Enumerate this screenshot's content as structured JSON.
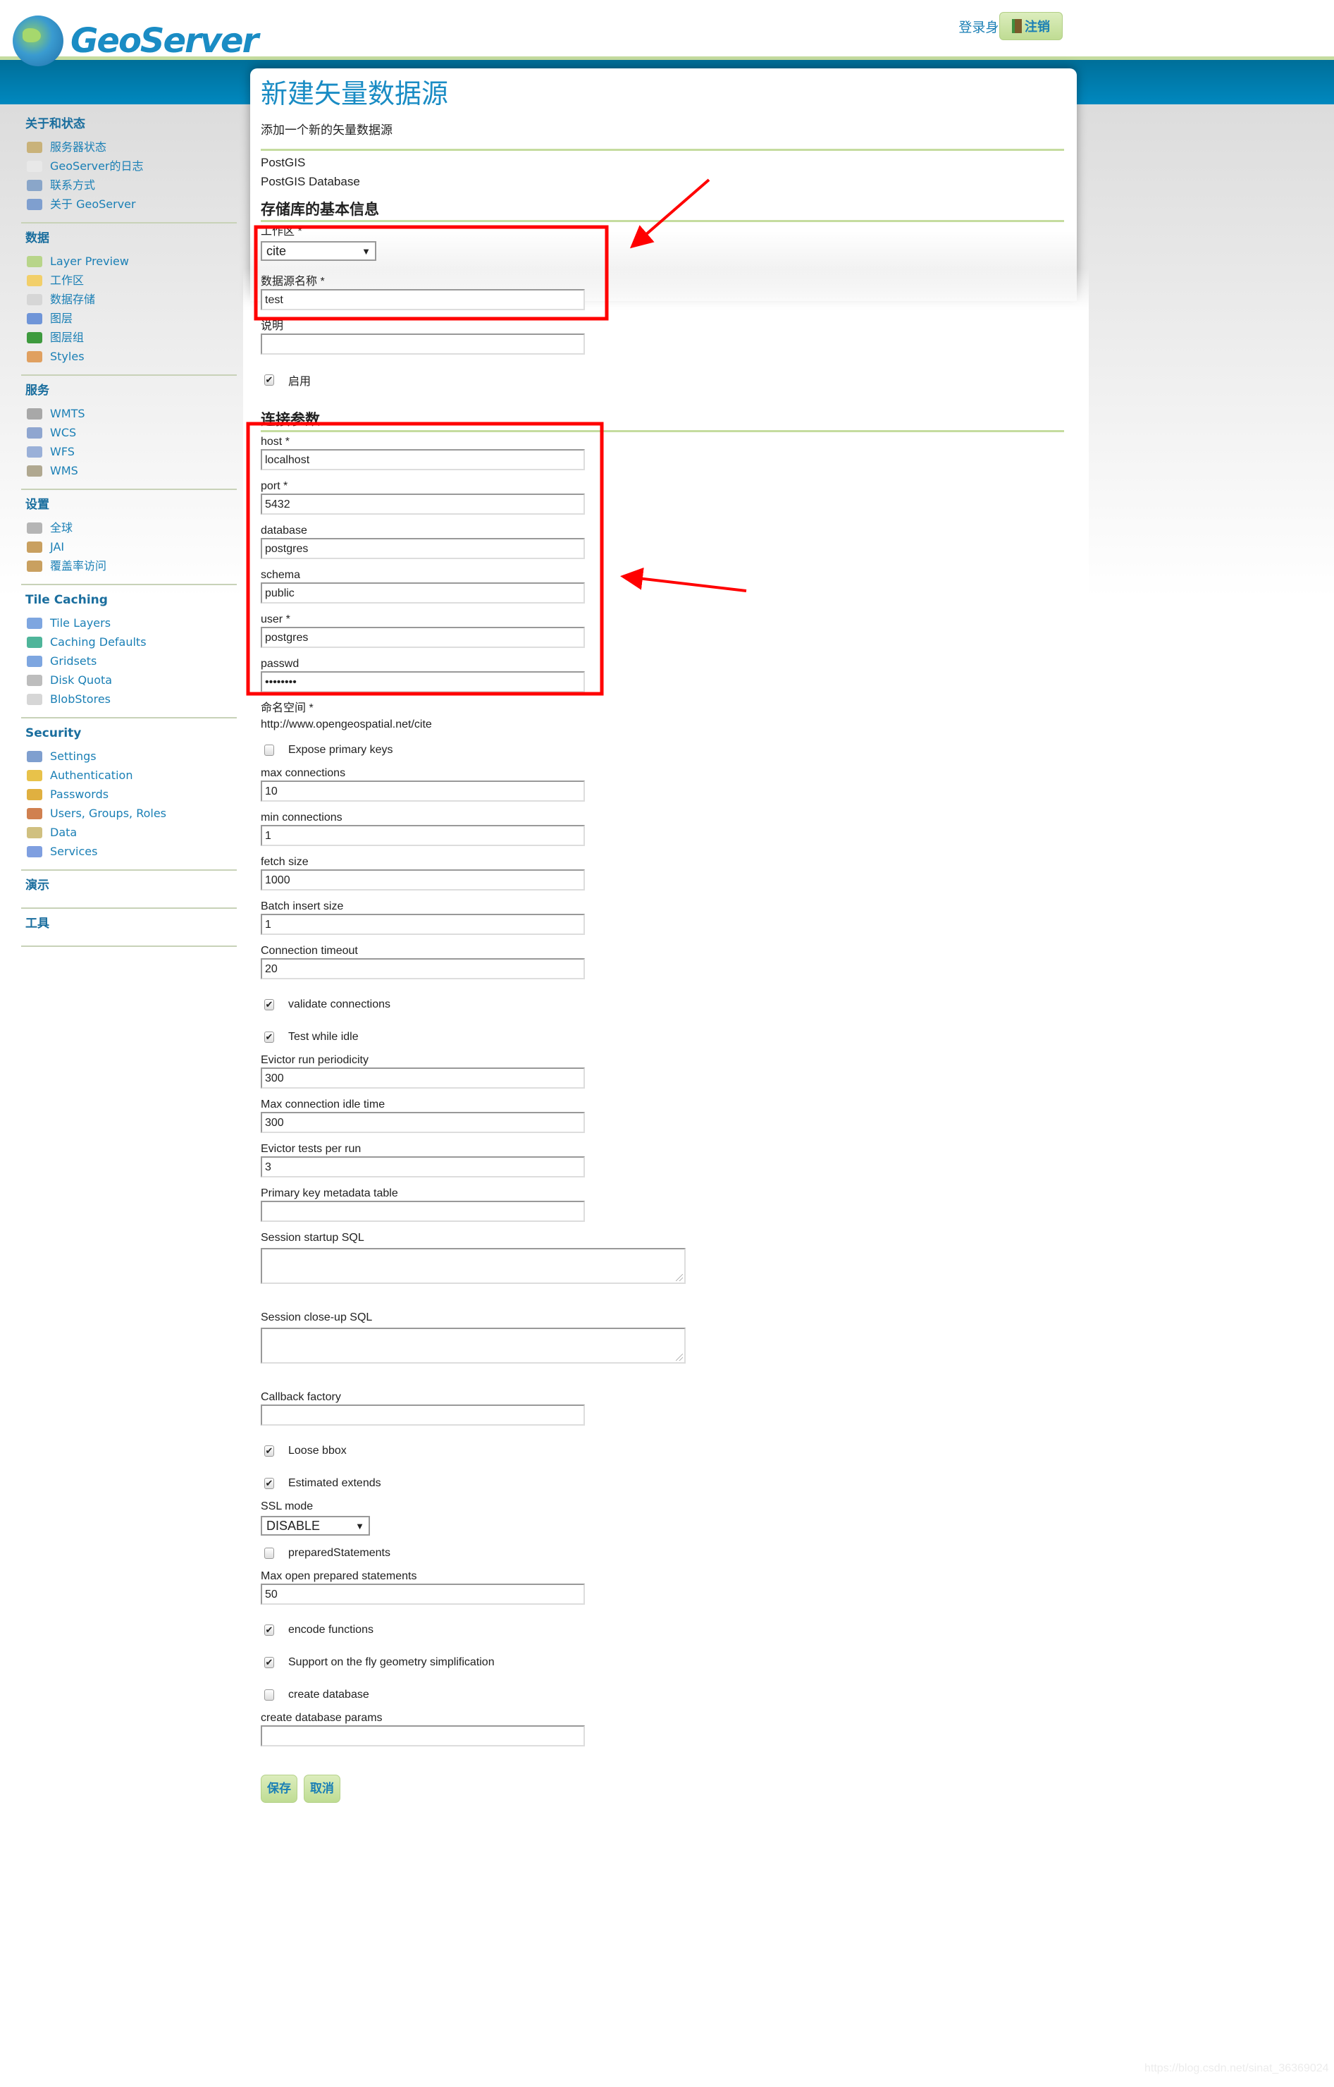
{
  "header": {
    "logo_text": "GeoServer",
    "login_text": "登录身份 admin.",
    "logout_label": "注销"
  },
  "sidebar": [
    {
      "title": "关于和状态",
      "items": [
        {
          "label": "服务器状态",
          "icon": "server-status-icon",
          "color": "#c9b27a"
        },
        {
          "label": "GeoServer的日志",
          "icon": "log-document-icon",
          "color": "#e8e8e8"
        },
        {
          "label": "联系方式",
          "icon": "contact-card-icon",
          "color": "#8aa6c9"
        },
        {
          "label": "关于 GeoServer",
          "icon": "help-icon",
          "color": "#7f9fcf"
        }
      ]
    },
    {
      "title": "数据",
      "items": [
        {
          "label": "Layer Preview",
          "icon": "layer-preview-icon",
          "color": "#b8d58a"
        },
        {
          "label": "工作区",
          "icon": "folder-icon",
          "color": "#f2cf6a"
        },
        {
          "label": "数据存储",
          "icon": "database-icon",
          "color": "#d6d6d6"
        },
        {
          "label": "图层",
          "icon": "layer-icon",
          "color": "#6f95d8"
        },
        {
          "label": "图层组",
          "icon": "layer-group-icon",
          "color": "#3e9a3e"
        },
        {
          "label": "Styles",
          "icon": "palette-icon",
          "color": "#e0a060"
        }
      ]
    },
    {
      "title": "服务",
      "items": [
        {
          "label": "WMTS",
          "icon": "wmts-service-icon",
          "color": "#a8a8a8"
        },
        {
          "label": "WCS",
          "icon": "wcs-service-icon",
          "color": "#8fa6d0"
        },
        {
          "label": "WFS",
          "icon": "wfs-service-icon",
          "color": "#9ab0d8"
        },
        {
          "label": "WMS",
          "icon": "wms-service-icon",
          "color": "#b0a890"
        }
      ]
    },
    {
      "title": "设置",
      "items": [
        {
          "label": "全球",
          "icon": "global-settings-icon",
          "color": "#b5b5b5"
        },
        {
          "label": "JAI",
          "icon": "jai-icon",
          "color": "#c9a060"
        },
        {
          "label": "覆盖率访问",
          "icon": "coverage-access-icon",
          "color": "#c9a060"
        }
      ]
    },
    {
      "title": "Tile Caching",
      "items": [
        {
          "label": "Tile Layers",
          "icon": "tile-layers-icon",
          "color": "#7ea6e0"
        },
        {
          "label": "Caching Defaults",
          "icon": "caching-globe-icon",
          "color": "#4fb59a"
        },
        {
          "label": "Gridsets",
          "icon": "gridsets-icon",
          "color": "#7ea6e0"
        },
        {
          "label": "Disk Quota",
          "icon": "disk-icon",
          "color": "#bdbdbd"
        },
        {
          "label": "BlobStores",
          "icon": "blobstore-icon",
          "color": "#d6d6d6"
        }
      ]
    },
    {
      "title": "Security",
      "items": [
        {
          "label": "Settings",
          "icon": "wrench-icon",
          "color": "#7f9fcf"
        },
        {
          "label": "Authentication",
          "icon": "shield-icon",
          "color": "#e8c24a"
        },
        {
          "label": "Passwords",
          "icon": "lock-icon",
          "color": "#e0b040"
        },
        {
          "label": "Users, Groups, Roles",
          "icon": "users-icon",
          "color": "#d08050"
        },
        {
          "label": "Data",
          "icon": "data-key-icon",
          "color": "#d0c080"
        },
        {
          "label": "Services",
          "icon": "services-key-icon",
          "color": "#7f9fe0"
        }
      ]
    },
    {
      "title": "演示",
      "items": []
    },
    {
      "title": "工具",
      "items": []
    }
  ],
  "main": {
    "title": "新建矢量数据源",
    "description": "添加一个新的矢量数据源",
    "store_type": "PostGIS",
    "store_type_desc": "PostGIS Database",
    "basic_section": "存储库的基本信息",
    "connection_section": "连接参数",
    "save_label": "保存",
    "cancel_label": "取消",
    "basic_fields": [
      {
        "type": "select",
        "label": "工作区 *",
        "value": "cite",
        "name": "workspace-select"
      },
      {
        "type": "text",
        "label": "数据源名称 *",
        "value": "test",
        "name": "datastore-name-input"
      },
      {
        "type": "text",
        "label": "说明",
        "value": "",
        "name": "description-input"
      },
      {
        "type": "checkbox",
        "label": "启用",
        "checked": true,
        "name": "enabled-checkbox"
      }
    ],
    "connection_fields": [
      {
        "type": "text",
        "label": "host *",
        "value": "localhost",
        "name": "host-input"
      },
      {
        "type": "text",
        "label": "port *",
        "value": "5432",
        "name": "port-input"
      },
      {
        "type": "text",
        "label": "database",
        "value": "postgres",
        "name": "database-input"
      },
      {
        "type": "text",
        "label": "schema",
        "value": "public",
        "name": "schema-input"
      },
      {
        "type": "text",
        "label": "user *",
        "value": "postgres",
        "name": "user-input"
      },
      {
        "type": "text",
        "label": "passwd",
        "value": "••••••••",
        "name": "password-input"
      },
      {
        "type": "static",
        "label": "命名空间 *",
        "value": "http://www.opengeospatial.net/cite",
        "name": "namespace"
      },
      {
        "type": "checkbox",
        "label": "Expose primary keys",
        "checked": false,
        "name": "expose-primary-keys-checkbox"
      },
      {
        "type": "text",
        "label": "max connections",
        "value": "10",
        "name": "max-connections-input"
      },
      {
        "type": "text",
        "label": "min connections",
        "value": "1",
        "name": "min-connections-input"
      },
      {
        "type": "text",
        "label": "fetch size",
        "value": "1000",
        "name": "fetch-size-input"
      },
      {
        "type": "text",
        "label": "Batch insert size",
        "value": "1",
        "name": "batch-insert-size-input"
      },
      {
        "type": "text",
        "label": "Connection timeout",
        "value": "20",
        "name": "connection-timeout-input"
      },
      {
        "type": "checkbox",
        "label": "validate connections",
        "checked": true,
        "name": "validate-connections-checkbox"
      },
      {
        "type": "checkbox",
        "label": "Test while idle",
        "checked": true,
        "name": "test-while-idle-checkbox"
      },
      {
        "type": "text",
        "label": "Evictor run periodicity",
        "value": "300",
        "name": "evictor-run-periodicity-input"
      },
      {
        "type": "text",
        "label": "Max connection idle time",
        "value": "300",
        "name": "max-idle-time-input"
      },
      {
        "type": "text",
        "label": "Evictor tests per run",
        "value": "3",
        "name": "evictor-tests-input"
      },
      {
        "type": "text",
        "label": "Primary key metadata table",
        "value": "",
        "name": "pk-metadata-table-input"
      },
      {
        "type": "textarea",
        "label": "Session startup SQL",
        "value": "",
        "name": "session-startup-sql-textarea"
      },
      {
        "type": "textarea",
        "label": "Session close-up SQL",
        "value": "",
        "name": "session-closeup-sql-textarea"
      },
      {
        "type": "text",
        "label": "Callback factory",
        "value": "",
        "name": "callback-factory-input"
      },
      {
        "type": "checkbox",
        "label": "Loose bbox",
        "checked": true,
        "name": "loose-bbox-checkbox"
      },
      {
        "type": "checkbox",
        "label": "Estimated extends",
        "checked": true,
        "name": "estimated-extends-checkbox"
      },
      {
        "type": "select",
        "label": "SSL mode",
        "value": "DISABLE",
        "name": "ssl-mode-select"
      },
      {
        "type": "checkbox",
        "label": "preparedStatements",
        "checked": false,
        "name": "prepared-statements-checkbox"
      },
      {
        "type": "text",
        "label": "Max open prepared statements",
        "value": "50",
        "name": "max-prepared-statements-input"
      },
      {
        "type": "checkbox",
        "label": "encode functions",
        "checked": true,
        "name": "encode-functions-checkbox"
      },
      {
        "type": "checkbox",
        "label": "Support on the fly geometry simplification",
        "checked": true,
        "name": "geometry-simplification-checkbox"
      },
      {
        "type": "checkbox",
        "label": "create database",
        "checked": false,
        "name": "create-database-checkbox"
      },
      {
        "type": "text",
        "label": "create database params",
        "value": "",
        "name": "create-database-params-input"
      }
    ]
  },
  "annotation_color": "#ff0000",
  "watermark": "https://blog.csdn.net/sinat_36369024"
}
